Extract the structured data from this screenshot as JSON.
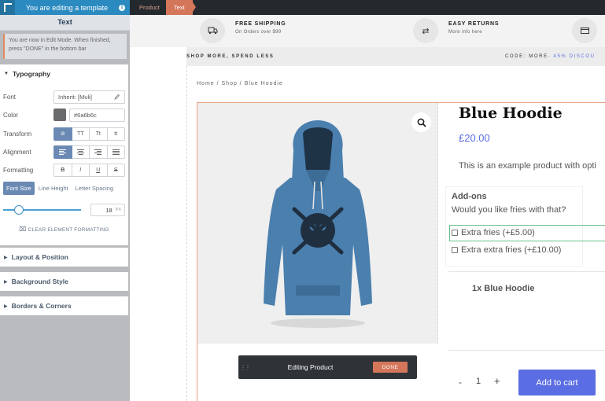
{
  "editor": {
    "top_title": "You are editing a template",
    "section_title": "Text",
    "notice": "You are now in Edit Mode. When finished, press \"DONE\" in the bottom bar",
    "typography_title": "Typography",
    "font_label": "Font",
    "font_value": "Inherit: [Muli]",
    "color_label": "Color",
    "color_value": "#6a6b6c",
    "transform_label": "Transform",
    "transform_options": [
      "⊘",
      "TT",
      "Tt",
      "tt"
    ],
    "alignment_label": "Alignment",
    "formatting_label": "Formatting",
    "formatting_options": [
      "B",
      "I",
      "U",
      "S"
    ],
    "size_tabs": [
      "Font Size",
      "Line Height",
      "Letter Spacing"
    ],
    "font_size_value": "18",
    "font_size_unit": "PX",
    "font_size_slider_fraction": 0.2,
    "clear_formatting": "CLEAR ELEMENT FORMATTING",
    "collapsed_sections": [
      "Layout & Position",
      "Background Style",
      "Borders & Corners"
    ]
  },
  "site": {
    "breadcrumb_tabs": [
      "Product",
      "Text"
    ],
    "shipping": {
      "free_title": "FREE SHIPPING",
      "free_sub": "On Orders over $99",
      "returns_title": "EASY RETURNS",
      "returns_sub": "More info here"
    },
    "promo_text": "SHOP MORE, SPEND LESS",
    "promo_code_label": "CODE: MORE",
    "promo_code_highlight": "- 45% DISCOU",
    "page_breadcrumb": "Home / Shop / Blue Hoodie",
    "product": {
      "title": "Blue Hoodie",
      "price": "£20.00",
      "description": "This is an example product with opti",
      "addons_heading": "Add-ons",
      "addons_question": "Would you like fries with that?",
      "addon_options": [
        "Extra fries (+£5.00)",
        "Extra extra fries (+£10.00)"
      ],
      "bundle_item": "1x Blue Hoodie",
      "quantity": "1",
      "qty_minus": "-",
      "qty_plus": "+",
      "add_to_cart": "Add to cart"
    },
    "editing_bar": {
      "label": "Editing Product",
      "done": "DONE"
    }
  },
  "colors": {
    "editor_blue": "#2b8ac0",
    "accent_orange": "#d4765a",
    "link_blue": "#5a6de2",
    "hoodie_blue": "#4a7fae"
  }
}
